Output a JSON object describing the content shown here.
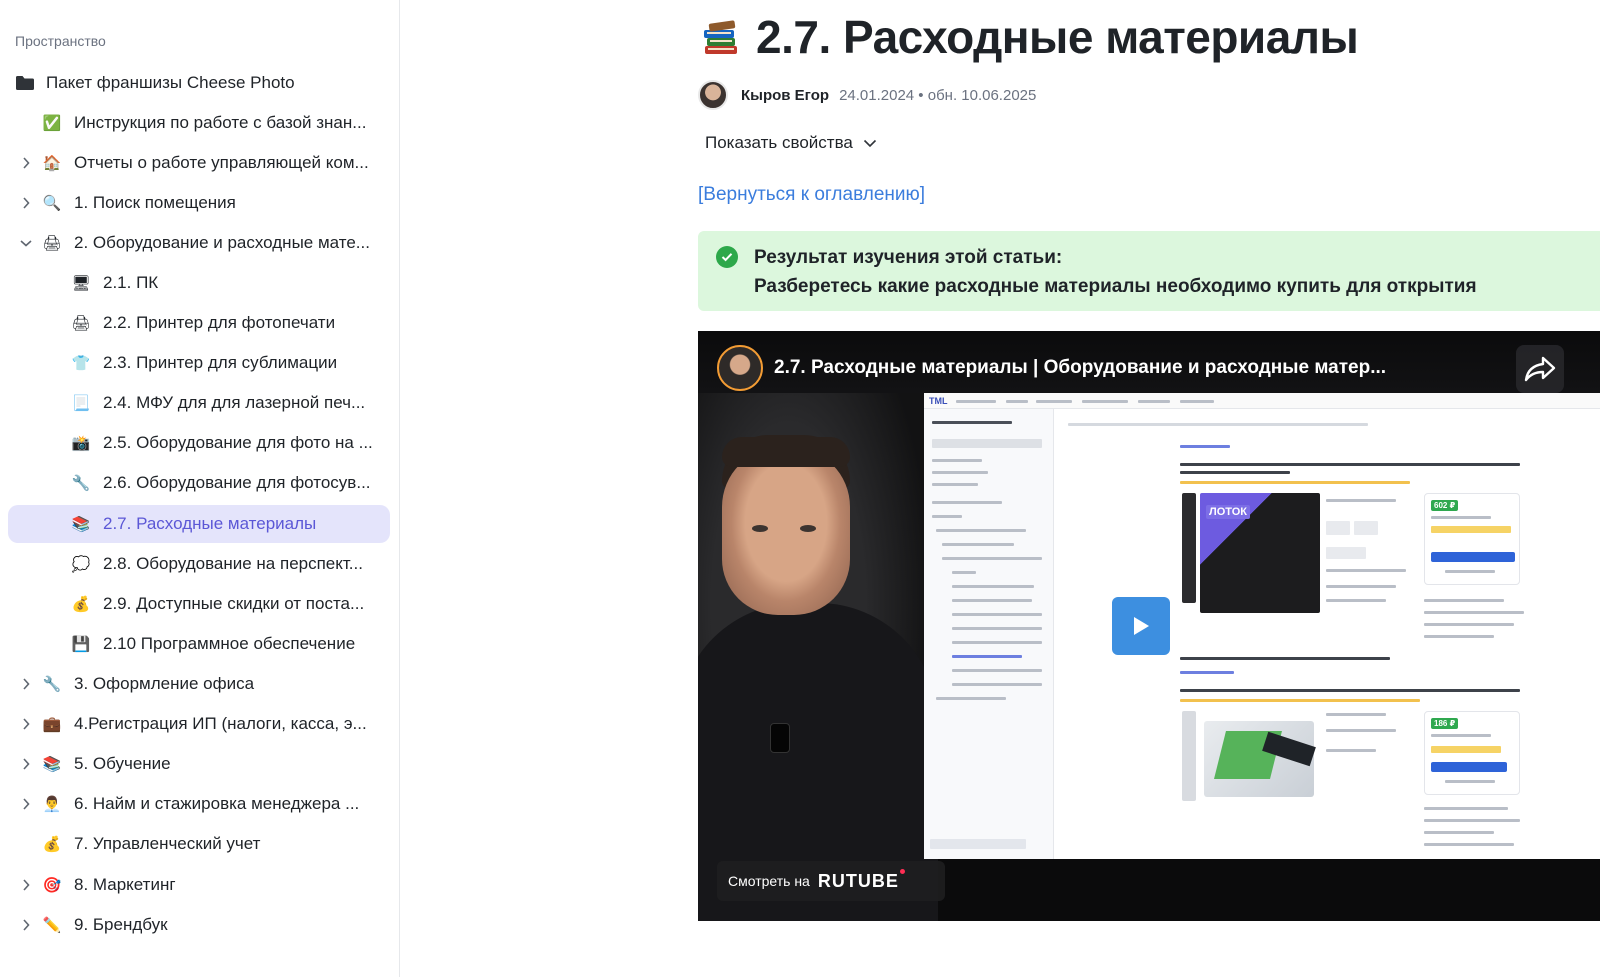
{
  "sidebar": {
    "space_label": "Пространство",
    "items": [
      {
        "label": "Пакет франшизы Cheese Photo",
        "icon": "folder-icon"
      },
      {
        "label": "Инструкция по работе с базой знан...",
        "icon": "check-box-icon",
        "glyph": "✅"
      },
      {
        "label": "Отчеты о работе управляющей ком...",
        "icon": "house-icon",
        "glyph": "🏠"
      },
      {
        "label": "1. Поиск помещения",
        "icon": "magnifier-icon",
        "glyph": "🔍"
      },
      {
        "label": "2. Оборудование и расходные мате...",
        "icon": "printer-icon",
        "glyph": "🖨"
      },
      {
        "label": "2.1. ПК",
        "icon": "desktop-icon",
        "glyph": "🖥"
      },
      {
        "label": "2.2. Принтер для фотопечати",
        "icon": "printer-icon",
        "glyph": "🖨"
      },
      {
        "label": "2.3. Принтер для сублимации",
        "icon": "tshirt-icon",
        "glyph": "👕"
      },
      {
        "label": "2.4. МФУ для для лазерной печ...",
        "icon": "document-icon",
        "glyph": "📃"
      },
      {
        "label": "2.5. Оборудование для фото на ...",
        "icon": "camera-icon",
        "glyph": "📸"
      },
      {
        "label": "2.6. Оборудование для фотосув...",
        "icon": "wrench-icon",
        "glyph": "🔧"
      },
      {
        "label": "2.7. Расходные материалы",
        "icon": "books-icon",
        "glyph": "📚"
      },
      {
        "label": "2.8. Оборудование на перспект...",
        "icon": "speech-bubble-icon",
        "glyph": "💭"
      },
      {
        "label": "2.9. Доступные скидки от поста...",
        "icon": "money-bag-icon",
        "glyph": "💰"
      },
      {
        "label": "2.10 Программное обеспечение",
        "icon": "floppy-disk-icon",
        "glyph": "💾"
      },
      {
        "label": "3. Оформление офиса",
        "icon": "wrench-icon",
        "glyph": "🔧"
      },
      {
        "label": "4.Регистрация ИП (налоги, касса, э...",
        "icon": "briefcase-icon",
        "glyph": "💼"
      },
      {
        "label": "5. Обучение",
        "icon": "books-icon",
        "glyph": "📚"
      },
      {
        "label": "6. Найм и стажировка менеджера ...",
        "icon": "person-icon",
        "glyph": "👨‍💼"
      },
      {
        "label": "7. Управленческий учет",
        "icon": "money-bag-icon",
        "glyph": "💰"
      },
      {
        "label": "8. Маркетинг",
        "icon": "target-icon",
        "glyph": "🎯"
      },
      {
        "label": "9. Брендбук",
        "icon": "pencil-icon",
        "glyph": "✏️"
      }
    ]
  },
  "page": {
    "title": "2.7. Расходные материалы",
    "title_icon": "books-icon",
    "author": "Кыров Егор",
    "dates": "24.01.2024 • обн. 10.06.2025",
    "show_properties": "Показать свойства",
    "back_link": "[Вернуться к оглавлению]",
    "callout": {
      "line1": "Результат изучения этой статьи:",
      "line2": "Разберетесь какие расходные материалы необходимо купить для открытия"
    }
  },
  "video": {
    "title": "2.7. Расходные материалы | Оборудование и расходные матер...",
    "watch_label": "Смотреть на",
    "platform": "RUTUBE",
    "screen": {
      "logo": "TML",
      "badge1": "602 ₽",
      "badge2": "186 ₽",
      "product_tag": "ЛОТОК"
    }
  },
  "colors": {
    "accent": "#5b57d6",
    "active_bg": "#e4e4fb",
    "link": "#3b7ddd",
    "callout_bg": "#dcf7dd",
    "success": "#2da84a",
    "play": "#3d8fe0"
  }
}
